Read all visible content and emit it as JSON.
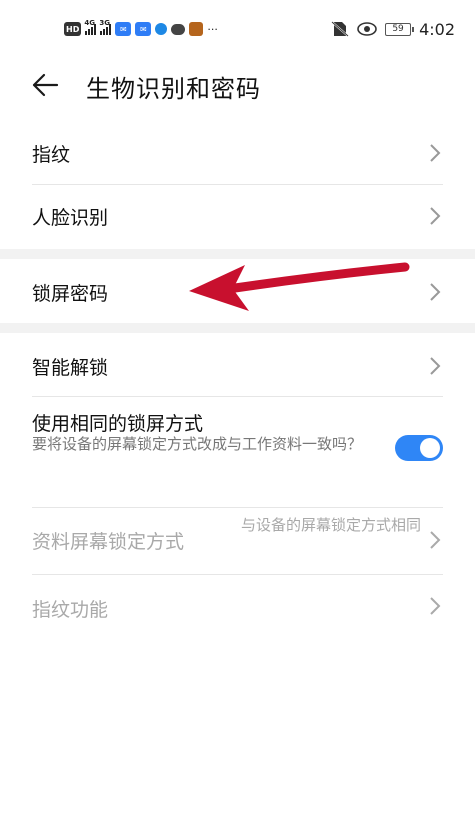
{
  "status_bar": {
    "left_icons": [
      "hd-icon",
      "signal-4g-icon",
      "signal-3g-icon",
      "app-notification-icon",
      "app-notification-icon",
      "browser-icon",
      "wechat-icon",
      "game-icon"
    ],
    "hd_label": "HD",
    "sig1_label": "4G",
    "sig2_label": "3G",
    "more_label": "···",
    "battery_level": "59",
    "time": "4:02"
  },
  "header": {
    "title": "生物识别和密码"
  },
  "items": {
    "fingerprint": {
      "label": "指纹"
    },
    "face": {
      "label": "人脸识别"
    },
    "lock_password": {
      "label": "锁屏密码"
    },
    "smart_unlock": {
      "label": "智能解锁"
    },
    "same_lock": {
      "label": "使用相同的锁屏方式",
      "description": "要将设备的屏幕锁定方式改成与工作资料一致吗？",
      "enabled": true
    },
    "profile_lock": {
      "label": "资料屏幕锁定方式",
      "value": "与设备的屏幕锁定方式相同"
    },
    "fingerprint_functions": {
      "label": "指纹功能"
    }
  },
  "colors": {
    "accent": "#2f86f6",
    "annotation_arrow": "#c8102e",
    "section_gap": "#f2f2f2"
  }
}
